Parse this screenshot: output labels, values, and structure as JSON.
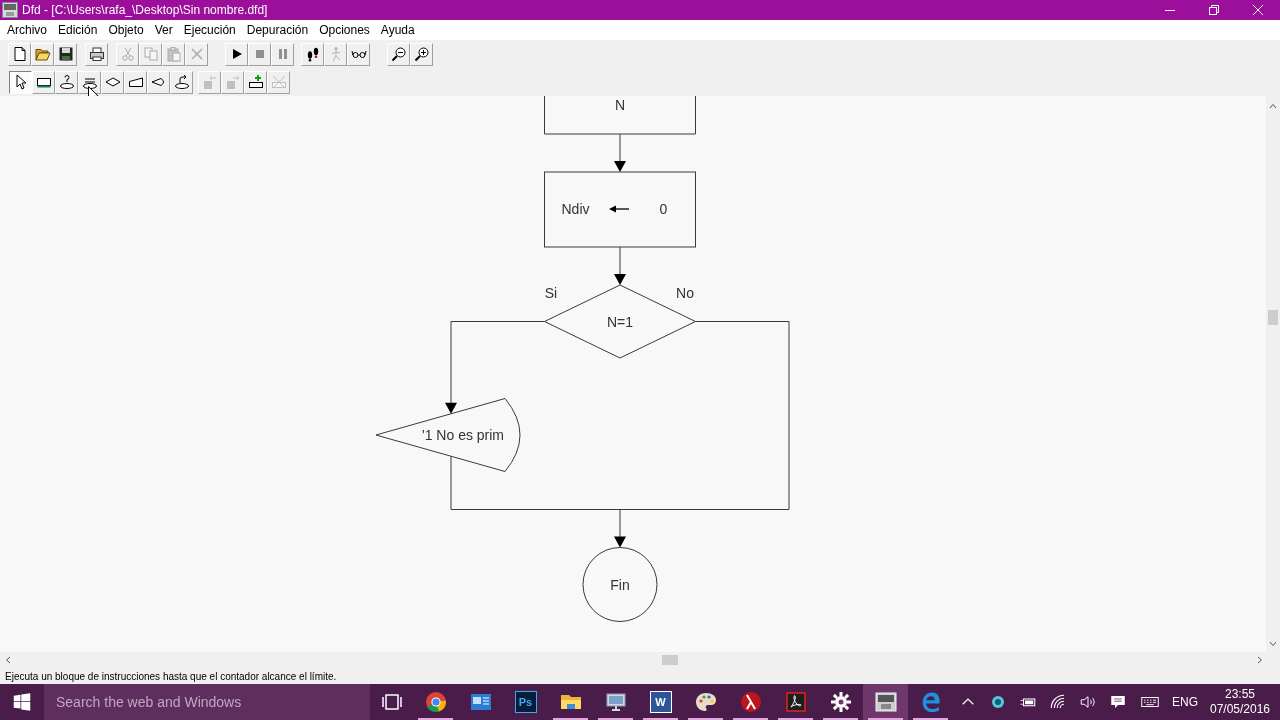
{
  "window": {
    "title": "Dfd - [C:\\Users\\rafa_\\Desktop\\Sin nombre.dfd]"
  },
  "menu": [
    "Archivo",
    "Edición",
    "Objeto",
    "Ver",
    "Ejecución",
    "Depuración",
    "Opciones",
    "Ayuda"
  ],
  "toolbars": [
    [
      [
        {
          "kind": "new",
          "disabled": false
        },
        {
          "kind": "open",
          "disabled": false
        },
        {
          "kind": "save",
          "disabled": false
        }
      ],
      [
        {
          "kind": "print",
          "disabled": false
        }
      ],
      [
        {
          "kind": "cut",
          "disabled": true
        },
        {
          "kind": "copy",
          "disabled": true
        },
        {
          "kind": "paste",
          "disabled": true
        },
        {
          "kind": "delete",
          "disabled": true
        }
      ],
      [
        {
          "kind": "run",
          "disabled": false
        },
        {
          "kind": "stop",
          "disabled": true
        },
        {
          "kind": "pause",
          "disabled": true
        }
      ],
      [
        {
          "kind": "step",
          "disabled": false
        },
        {
          "kind": "walk",
          "disabled": true
        },
        {
          "kind": "watch",
          "disabled": false
        }
      ],
      [
        {
          "kind": "zoom-out",
          "disabled": false
        },
        {
          "kind": "zoom-in",
          "disabled": false
        }
      ]
    ],
    [
      [
        {
          "kind": "pointer",
          "selected": true
        },
        {
          "kind": "assignment",
          "selected": false
        },
        {
          "kind": "read",
          "selected": false
        },
        {
          "kind": "loop",
          "selected": false
        },
        {
          "kind": "decision",
          "selected": false
        },
        {
          "kind": "input",
          "selected": false
        },
        {
          "kind": "output",
          "selected": false
        },
        {
          "kind": "call",
          "selected": false
        }
      ],
      [
        {
          "kind": "move-left",
          "disabled": true
        },
        {
          "kind": "move-right",
          "disabled": true
        },
        {
          "kind": "insert",
          "disabled": false
        },
        {
          "kind": "remove",
          "disabled": true
        }
      ]
    ]
  ],
  "flowchart": {
    "nodes": [
      {
        "kind": "box",
        "text": "N"
      },
      {
        "kind": "assignment",
        "variable": "Ndiv",
        "value": "0"
      },
      {
        "kind": "decision",
        "condition": "N=1",
        "yes_label": "Si",
        "no_label": "No",
        "yes_branch": [
          {
            "kind": "output",
            "text": "'1 No es prim"
          }
        ]
      },
      {
        "kind": "end",
        "text": "Fin"
      }
    ]
  },
  "status_bar": {
    "text": "Ejecuta un bloque de instrucciones hasta que el contador alcance el límite."
  },
  "taskbar": {
    "search": {
      "placeholder": "Search the web and Windows"
    },
    "apps": [
      {
        "kind": "chrome",
        "running": true,
        "active": false
      },
      {
        "kind": "card",
        "running": false,
        "active": false
      },
      {
        "kind": "tile",
        "label": "Ps",
        "running": false,
        "active": false
      },
      {
        "kind": "folder",
        "running": true,
        "active": false
      },
      {
        "kind": "computer",
        "running": true,
        "active": false
      },
      {
        "kind": "word",
        "label": "W",
        "running": true,
        "active": false
      },
      {
        "kind": "palette",
        "running": true,
        "active": false
      },
      {
        "kind": "lambda",
        "running": true,
        "active": false
      },
      {
        "kind": "swirl",
        "running": true,
        "active": false
      },
      {
        "kind": "gear",
        "running": true,
        "active": false
      },
      {
        "kind": "dfd",
        "running": true,
        "active": true
      },
      {
        "kind": "edge",
        "running": true,
        "active": false
      }
    ],
    "tray": {
      "language": "ENG",
      "time": "23:55",
      "date": "07/05/2016"
    }
  }
}
